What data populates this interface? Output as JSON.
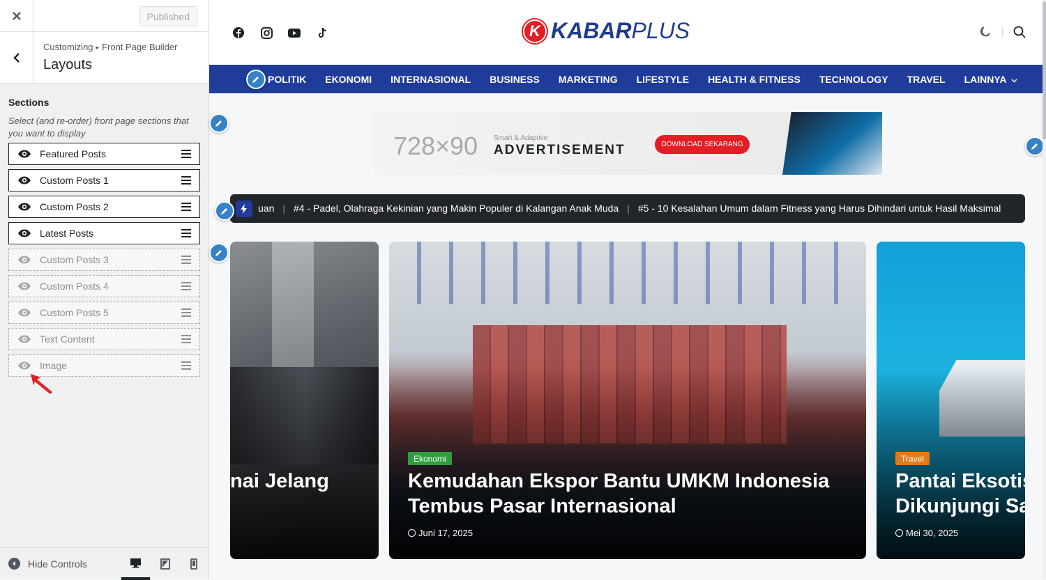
{
  "sidebar": {
    "published_label": "Published",
    "breadcrumb": [
      "Customizing",
      "Front Page Builder"
    ],
    "breadcrumb_sep": "▸",
    "title": "Layouts",
    "sections_title": "Sections",
    "sections_desc": "Select (and re-order) front page sections that you want to display",
    "sections": [
      {
        "label": "Featured Posts",
        "visible": true
      },
      {
        "label": "Custom Posts 1",
        "visible": true
      },
      {
        "label": "Custom Posts 2",
        "visible": true
      },
      {
        "label": "Latest Posts",
        "visible": true
      },
      {
        "label": "Custom Posts 3",
        "visible": false
      },
      {
        "label": "Custom Posts 4",
        "visible": false
      },
      {
        "label": "Custom Posts 5",
        "visible": false
      },
      {
        "label": "Text Content",
        "visible": false
      },
      {
        "label": "Image",
        "visible": false
      }
    ],
    "hide_controls_label": "Hide Controls",
    "devices": [
      "desktop-icon",
      "tablet-icon",
      "mobile-icon"
    ]
  },
  "site": {
    "logo_letter": "K",
    "logo_brand": "KABAR",
    "logo_suffix": "PLUS",
    "social": [
      "facebook-icon",
      "instagram-icon",
      "youtube-icon",
      "tiktok-icon"
    ],
    "nav": [
      "POLITIK",
      "EKONOMI",
      "INTERNASIONAL",
      "BUSINESS",
      "MARKETING",
      "LIFESTYLE",
      "HEALTH & FITNESS",
      "TECHNOLOGY",
      "TRAVEL",
      "LAINNYA"
    ],
    "ad": {
      "size": "728×90",
      "tagline": "Smart & Adaptive",
      "headline": "ADVERTISEMENT",
      "cta": "DOWNLOAD SEKARANG"
    },
    "ticker": {
      "items": [
        "uan",
        "#4 - Padel, Olahraga Kekinian yang Makin Populer di Kalangan Anak Muda",
        "#5 - 10 Kesalahan Umum dalam Fitness yang Harus Dihindari untuk Hasil Maksimal"
      ]
    },
    "cards": [
      {
        "category": "",
        "title": "nai Jelang",
        "date": ""
      },
      {
        "category": "Ekonomi",
        "title": "Kemudahan Ekspor Bantu UMKM Indonesia Tembus Pasar Internasional",
        "date": "Juni 17, 2025"
      },
      {
        "category": "Travel",
        "title": "Pantai Eksotis Dikunjungi Sa",
        "date": "Mei 30, 2025"
      }
    ]
  },
  "colors": {
    "nav_bg": "#1f3c9b",
    "brand_red": "#e31e24",
    "ekonomi_badge": "#2e9e3e",
    "travel_badge": "#e07b1a",
    "edit_pin": "#3582c4"
  }
}
